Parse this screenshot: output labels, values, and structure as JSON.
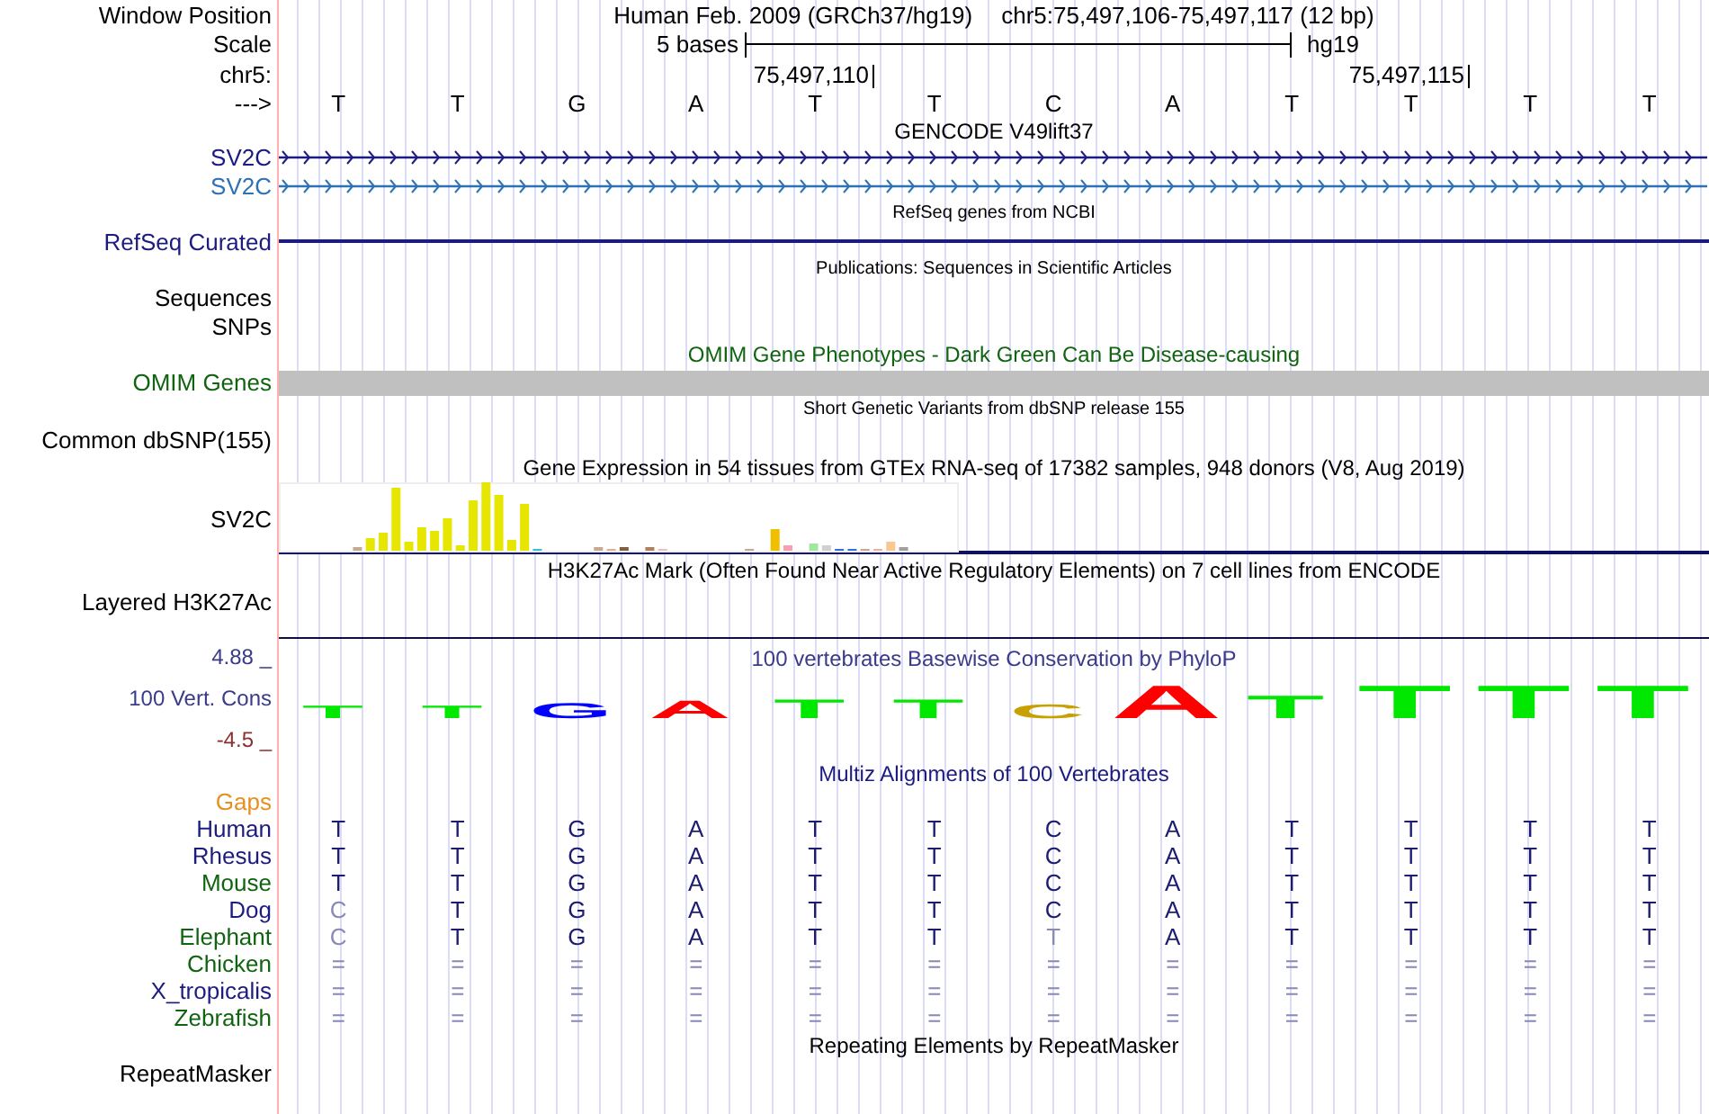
{
  "header": {
    "label": "Window Position",
    "assembly": "Human Feb. 2009 (GRCh37/hg19)",
    "position": "chr5:75,497,106-75,497,117 (12 bp)"
  },
  "scale": {
    "label": "Scale",
    "bar_label": "5 bases",
    "assembly": "hg19"
  },
  "coordinates": {
    "label": "chr5:",
    "ticks": [
      "75,497,110",
      "75,497,115"
    ]
  },
  "sequence": {
    "label": "--->",
    "bases": [
      "T",
      "T",
      "G",
      "A",
      "T",
      "T",
      "C",
      "A",
      "T",
      "T",
      "T",
      "T"
    ]
  },
  "gencode": {
    "title": "GENCODE V49lift37",
    "genes": [
      {
        "name": "SV2C",
        "color": "#1c1c80"
      },
      {
        "name": "SV2C",
        "color": "#2c72b4"
      }
    ]
  },
  "refseq": {
    "title": "RefSeq genes from NCBI",
    "label": "RefSeq Curated"
  },
  "publications": {
    "title": "Publications: Sequences in Scientific Articles",
    "label": "Sequences"
  },
  "snps": {
    "label": "SNPs"
  },
  "omim": {
    "title": "OMIM Gene Phenotypes - Dark Green Can Be Disease-causing",
    "label": "OMIM Genes"
  },
  "dbsnp": {
    "title": "Short Genetic Variants from dbSNP release 155",
    "label": "Common dbSNP(155)"
  },
  "gtex": {
    "title": "Gene Expression in 54 tissues from GTEx RNA-seq of 17382 samples, 948 donors (V8, Aug 2019)",
    "label": "SV2C"
  },
  "h3k27ac": {
    "title": "H3K27Ac Mark (Often Found Near Active Regulatory Elements) on 7 cell lines from ENCODE",
    "label": "Layered H3K27Ac"
  },
  "conservation": {
    "title": "100 vertebrates Basewise Conservation by PhyloP",
    "label": "100 Vert. Cons",
    "max": "4.88 _",
    "min": "-4.5 _",
    "logo": [
      {
        "base": "T",
        "color": "#00e800"
      },
      {
        "base": "T",
        "color": "#00e800"
      },
      {
        "base": "G",
        "color": "#0000ff"
      },
      {
        "base": "A",
        "color": "#ff0000"
      },
      {
        "base": "T",
        "color": "#00e800"
      },
      {
        "base": "T",
        "color": "#00e800"
      },
      {
        "base": "C",
        "color": "#c8a000"
      },
      {
        "base": "A",
        "color": "#ff0000"
      },
      {
        "base": "T",
        "color": "#00e800"
      },
      {
        "base": "T",
        "color": "#00e800"
      },
      {
        "base": "T",
        "color": "#00e800"
      },
      {
        "base": "T",
        "color": "#00e800"
      }
    ]
  },
  "multiz": {
    "title": "Multiz Alignments of 100 Vertebrates",
    "gaps_label": "Gaps",
    "species": [
      {
        "name": "Human",
        "color": "#1c1c80",
        "bases": [
          "T",
          "T",
          "G",
          "A",
          "T",
          "T",
          "C",
          "A",
          "T",
          "T",
          "T",
          "T"
        ],
        "faded": [
          false,
          false,
          false,
          false,
          false,
          false,
          false,
          false,
          false,
          false,
          false,
          false
        ]
      },
      {
        "name": "Rhesus",
        "color": "#1c1c80",
        "bases": [
          "T",
          "T",
          "G",
          "A",
          "T",
          "T",
          "C",
          "A",
          "T",
          "T",
          "T",
          "T"
        ],
        "faded": [
          false,
          false,
          false,
          false,
          false,
          false,
          false,
          false,
          false,
          false,
          false,
          false
        ]
      },
      {
        "name": "Mouse",
        "color": "#106410",
        "bases": [
          "T",
          "T",
          "G",
          "A",
          "T",
          "T",
          "C",
          "A",
          "T",
          "T",
          "T",
          "T"
        ],
        "faded": [
          false,
          false,
          false,
          false,
          false,
          false,
          false,
          false,
          false,
          false,
          false,
          false
        ]
      },
      {
        "name": "Dog",
        "color": "#1c1c80",
        "bases": [
          "C",
          "T",
          "G",
          "A",
          "T",
          "T",
          "C",
          "A",
          "T",
          "T",
          "T",
          "T"
        ],
        "faded": [
          true,
          false,
          false,
          false,
          false,
          false,
          false,
          false,
          false,
          false,
          false,
          false
        ]
      },
      {
        "name": "Elephant",
        "color": "#106410",
        "bases": [
          "C",
          "T",
          "G",
          "A",
          "T",
          "T",
          "T",
          "A",
          "T",
          "T",
          "T",
          "T"
        ],
        "faded": [
          true,
          false,
          false,
          false,
          false,
          false,
          true,
          false,
          false,
          false,
          false,
          false
        ]
      },
      {
        "name": "Chicken",
        "color": "#106410",
        "bases": [
          "=",
          "=",
          "=",
          "=",
          "=",
          "=",
          "=",
          "=",
          "=",
          "=",
          "=",
          "="
        ],
        "faded": [
          true,
          true,
          true,
          true,
          true,
          true,
          true,
          true,
          true,
          true,
          true,
          true
        ]
      },
      {
        "name": "X_tropicalis",
        "color": "#1c1c80",
        "bases": [
          "=",
          "=",
          "=",
          "=",
          "=",
          "=",
          "=",
          "=",
          "=",
          "=",
          "=",
          "="
        ],
        "faded": [
          true,
          true,
          true,
          true,
          true,
          true,
          true,
          true,
          true,
          true,
          true,
          true
        ]
      },
      {
        "name": "Zebrafish",
        "color": "#106410",
        "bases": [
          "=",
          "=",
          "=",
          "=",
          "=",
          "=",
          "=",
          "=",
          "=",
          "=",
          "=",
          "="
        ],
        "faded": [
          true,
          true,
          true,
          true,
          true,
          true,
          true,
          true,
          true,
          true,
          true,
          true
        ]
      }
    ]
  },
  "repeatmasker": {
    "title": "Repeating Elements by RepeatMasker",
    "label": "RepeatMasker"
  }
}
